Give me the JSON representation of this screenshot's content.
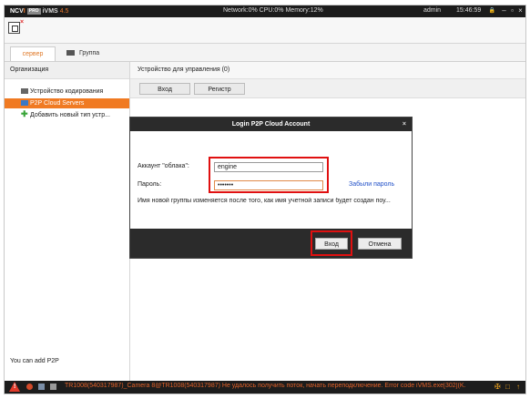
{
  "titlebar": {
    "logo": {
      "ncv": "NCV",
      "sep": "I",
      "pro": "PRO",
      "vms": "iVMS",
      "ver": "4.5"
    },
    "status": "Network:0%  CPU:0%  Memory:12%",
    "user": "admin",
    "time": "15:46:59",
    "icons": [
      "lock-icon",
      "minimize-icon",
      "maximize-icon",
      "close-icon"
    ],
    "glyphs": {
      "lock": "🔒",
      "minimize": "–",
      "maximize": "▫",
      "close": "×"
    }
  },
  "toolbar": {
    "close_glyph": "×"
  },
  "tabs": [
    {
      "label": "сервер",
      "active": true
    },
    {
      "label": "Группа",
      "active": false
    }
  ],
  "sidebar": {
    "header": "Организация",
    "items": [
      {
        "label": "Устройство кодирования",
        "icon": "encoder-icon"
      },
      {
        "label": "P2P Cloud Servers",
        "icon": "cloud-server-icon",
        "active": true
      },
      {
        "label": "Добавить новый тип устр...",
        "icon": "add-icon",
        "glyph": "✚"
      }
    ],
    "footer": "You can add P2P"
  },
  "main": {
    "header": "Устройство для управления (0)",
    "buttons": {
      "login": "Вход",
      "register": "Регистр"
    }
  },
  "dialog": {
    "title": "Login P2P Cloud Account",
    "close": "×",
    "account_label": "Аккаунт \"облака\":",
    "account_value": "engine",
    "password_label": "Пароль:",
    "password_value": "•••••••",
    "forgot": "Забыли пароль",
    "note": "Имя новой группы изменяется после того, как имя учетной записи будет создан поу...",
    "ok": "Вход",
    "cancel": "Отмена"
  },
  "statusbar": {
    "message": "TR1008(540317987)_Camera 8@TR1008(540317987) Не удалось получить поток, начать переподключение. Error code iVMS.exe[302](K...",
    "icons": [
      "warning-icon",
      "alarm-icon",
      "record-icon",
      "device-icon",
      "pin-icon",
      "window-icon",
      "collapse-icon"
    ],
    "glyphs": {
      "pin": "✠",
      "window": "□",
      "collapse": "↑"
    }
  },
  "colors": {
    "accent": "#f07a22",
    "highlight": "#e01010",
    "link": "#2050c8"
  }
}
